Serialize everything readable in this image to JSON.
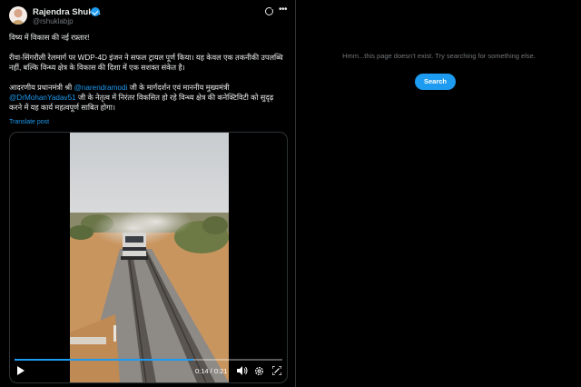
{
  "author": {
    "name": "Rajendra Shukla",
    "handle": "@rshuklabjp"
  },
  "post": {
    "line1": "विष्य में विकास की नई रफ़्तार!",
    "line2": "रीवा-सिंगरौली रेलमार्ग पर WDP-4D इंजन ने सफल ट्रायल पूर्ण किया। यह केवल एक तकनीकी उपलब्धि नहीं, बल्कि विन्ध्य क्षेत्र के विकास की दिशा में एक सशक्त संकेत है।",
    "p3_start": "आदरणीय प्रधानमंत्री श्री ",
    "mention1": "@narendramodi",
    "p3_mid": " जी के मार्गदर्शन एवं माननीय मुख्यमंत्री ",
    "mention2": "@DrMohanYadav51",
    "p3_end": " जी के नेतृत्व में निरंतर विकसित हो रहे विन्ध्य क्षेत्र की कनेक्टिविटी को सुदृढ़ करने में यह कार्य महत्वपूर्ण साबित होगा।",
    "translate_label": "Translate post"
  },
  "video": {
    "time": "0:14 / 0:21",
    "progress": 0.667
  },
  "right_panel": {
    "message": "Hmm...this page doesn't exist. Try searching for something else.",
    "search_label": "Search"
  },
  "colors": {
    "accent": "#1d9bf0",
    "background": "#000000",
    "text": "#e7e9ea",
    "muted": "#71767b"
  },
  "icons": [
    "verified-badge-icon",
    "grok-icon",
    "more-icon",
    "play-icon",
    "volume-icon",
    "settings-icon",
    "fullscreen-icon"
  ]
}
